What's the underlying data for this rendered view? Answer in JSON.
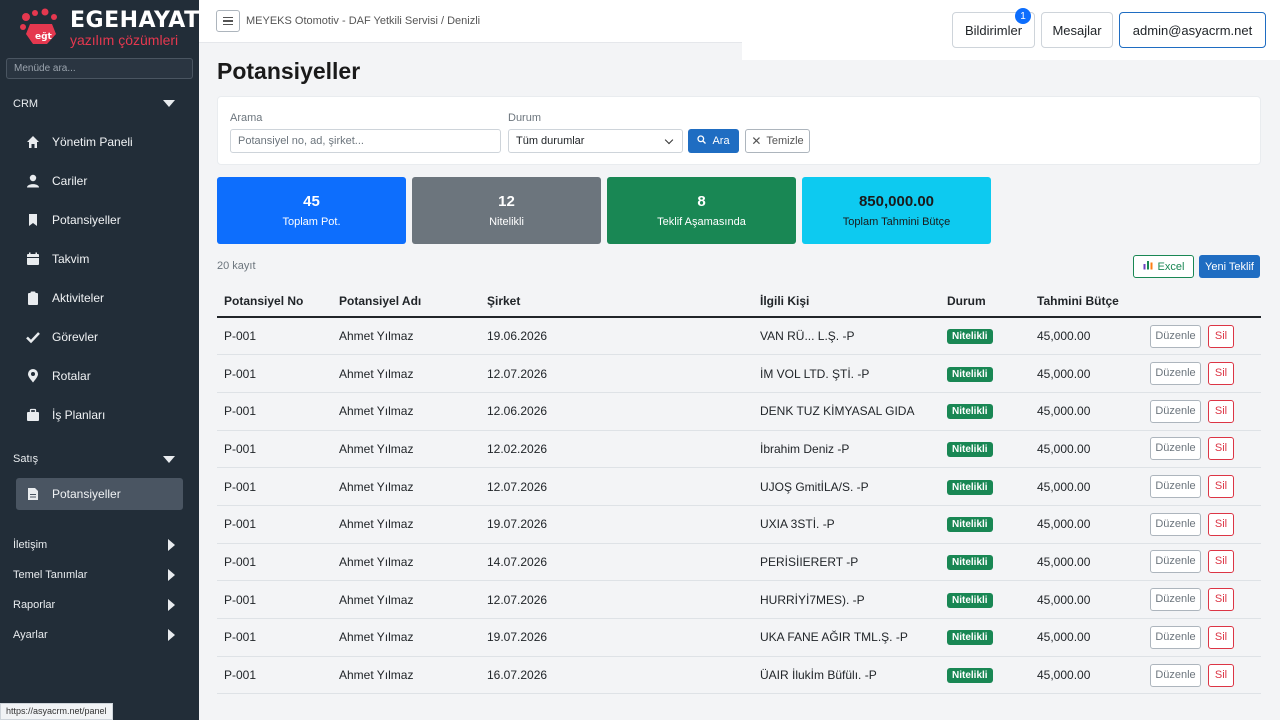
{
  "sidebar": {
    "logo_title": "EGEHAYAT",
    "logo_subtitle": "yazılım çözümleri",
    "search_placeholder": "Menüde ara...",
    "groups": [
      {
        "label": "CRM"
      },
      {
        "label": "Satış"
      },
      {
        "label": "İletişim"
      },
      {
        "label": "Temel Tanımlar"
      },
      {
        "label": "Raporlar"
      },
      {
        "label": "Ayarlar"
      }
    ],
    "crm_items": [
      {
        "label": "Yönetim Paneli",
        "icon": "home-icon"
      },
      {
        "label": "Cariler",
        "icon": "user-icon"
      },
      {
        "label": "Potansiyeller",
        "icon": "bookmark-icon"
      },
      {
        "label": "Takvim",
        "icon": "calendar-icon"
      },
      {
        "label": "Aktiviteler",
        "icon": "clipboard-icon"
      },
      {
        "label": "Görevler",
        "icon": "check-icon"
      },
      {
        "label": "Rotalar",
        "icon": "map-pin-icon"
      },
      {
        "label": "İş Planları",
        "icon": "briefcase-icon"
      }
    ],
    "sales_items": [
      {
        "label": "Potansiyeller",
        "icon": "file-icon"
      }
    ]
  },
  "topbar": {
    "breadcrumb": "MEYEKS Otomotiv - DAF Yetkili Servisi / Denizli",
    "notifications_label": "Bildirimler",
    "notifications_count": "1",
    "messages_label": "Mesajlar",
    "user_label": "admin@asyacrm.net"
  },
  "page": {
    "title": "Potansiyeller",
    "search_label": "Arama",
    "search_placeholder": "Potansiyel no, ad, şirket...",
    "status_label": "Durum",
    "status_value": "Tüm durumlar",
    "search_button": "Ara",
    "clear_button": "Temizle",
    "record_count": "20 kayıt",
    "excel_button": "Excel",
    "new_button": "Yeni Teklif"
  },
  "stats": [
    {
      "value": "45",
      "label": "Toplam Pot.",
      "color": "#0d6efd"
    },
    {
      "value": "12",
      "label": "Nitelikli",
      "color": "#6c757d"
    },
    {
      "value": "8",
      "label": "Teklif Aşamasında",
      "color": "#198754"
    },
    {
      "value": "850,000.00",
      "label": "Toplam Tahmini Bütçe",
      "color": "#0dcaf0"
    }
  ],
  "table": {
    "columns": [
      "Potansiyel No",
      "Potansiyel Adı",
      "Şirket",
      "İlgili Kişi",
      "Durum",
      "Tahmini Bütçe",
      ""
    ],
    "edit_label": "Düzenle",
    "delete_label": "Sil",
    "rows": [
      {
        "no": "P-001",
        "name": "Ahmet Yılmaz",
        "company": "19.06.2026",
        "contact": "VAN RÜ... L.Ş. -P",
        "status": "Nitelikli",
        "budget": "45,000.00"
      },
      {
        "no": "P-001",
        "name": "Ahmet Yılmaz",
        "company": "12.07.2026",
        "contact": "İM VOL LTD. ŞTİ. -P",
        "status": "Nitelikli",
        "budget": "45,000.00"
      },
      {
        "no": "P-001",
        "name": "Ahmet Yılmaz",
        "company": "12.06.2026",
        "contact": "DENK TUZ KİMYASAL GIDA",
        "status": "Nitelikli",
        "budget": "45,000.00"
      },
      {
        "no": "P-001",
        "name": "Ahmet Yılmaz",
        "company": "12.02.2026",
        "contact": "İbrahim Deniz -P",
        "status": "Nitelikli",
        "budget": "45,000.00"
      },
      {
        "no": "P-001",
        "name": "Ahmet Yılmaz",
        "company": "12.07.2026",
        "contact": "UJOŞ GmitİLA/S. -P",
        "status": "Nitelikli",
        "budget": "45,000.00"
      },
      {
        "no": "P-001",
        "name": "Ahmet Yılmaz",
        "company": "19.07.2026",
        "contact": "UXIA 3STİ. -P",
        "status": "Nitelikli",
        "budget": "45,000.00"
      },
      {
        "no": "P-001",
        "name": "Ahmet Yılmaz",
        "company": "14.07.2026",
        "contact": "PERİSİIERERT -P",
        "status": "Nitelikli",
        "budget": "45,000.00"
      },
      {
        "no": "P-001",
        "name": "Ahmet Yılmaz",
        "company": "12.07.2026",
        "contact": "HURRİYİ7MES). -P",
        "status": "Nitelikli",
        "budget": "45,000.00"
      },
      {
        "no": "P-001",
        "name": "Ahmet Yılmaz",
        "company": "19.07.2026",
        "contact": "UKA FANE AĞIR TML.Ş. -P",
        "status": "Nitelikli",
        "budget": "45,000.00"
      },
      {
        "no": "P-001",
        "name": "Ahmet Yılmaz",
        "company": "16.07.2026",
        "contact": "ÜAIR İlukİm Büfülı. -P",
        "status": "Nitelikli",
        "budget": "45,000.00"
      }
    ]
  },
  "status_bar_url": "https://asyacrm.net/panel"
}
